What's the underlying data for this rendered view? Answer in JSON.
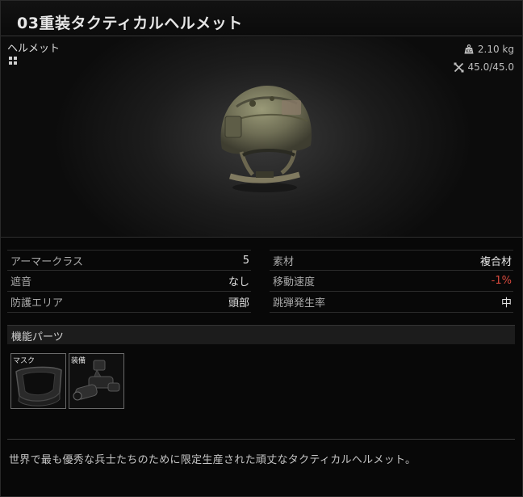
{
  "title": "03重装タクティカルヘルメット",
  "category": "ヘルメット",
  "weight": "2.10 kg",
  "durability": "45.0/45.0",
  "stats_left": [
    {
      "label": "アーマークラス",
      "value": "5"
    },
    {
      "label": "遮音",
      "value": "なし"
    },
    {
      "label": "防護エリア",
      "value": "頭部"
    }
  ],
  "stats_right": [
    {
      "label": "素材",
      "value": "複合材"
    },
    {
      "label": "移動速度",
      "value": "-1%"
    },
    {
      "label": "跳弾発生率",
      "value": "中"
    }
  ],
  "parts": {
    "header": "機能パーツ",
    "slots": [
      {
        "label": "マスク",
        "icon": "face-shield-icon"
      },
      {
        "label": "装備",
        "icon": "night-vision-icon"
      }
    ]
  },
  "description": "世界で最も優秀な兵士たちのために限定生産された頑丈なタクティカルヘルメット。",
  "colors": {
    "negative": "#d94a3e"
  }
}
